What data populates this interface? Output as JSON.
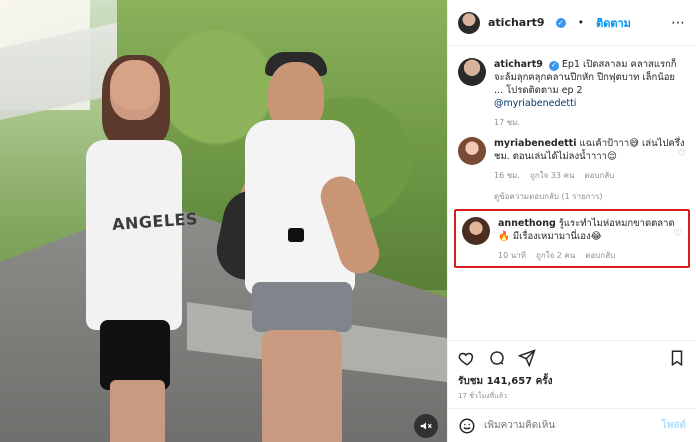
{
  "photo": {
    "shirt_text": "ANGELES",
    "mute_icon": "speaker-muted-icon"
  },
  "header": {
    "username": "atichart9",
    "follow_label": "ติดตาม",
    "more_icon": "more-horizontal-icon"
  },
  "post": {
    "caption_user": "atichart9",
    "caption_text": "Ep1 เปิดสลาลม คลาสแรกก็จะล้มลุกคลุกคลานปีกหัก ปีกฟุตบาท เล็กน้อย ... โปรดติดตาม ep 2",
    "caption_mention": "@myriabenedetti",
    "caption_time": "17 ชม."
  },
  "comments": [
    {
      "user": "myriabenedetti",
      "text": "แฉเค้าป้าาา😅 เล่นไปครึ่งชม. ตอนเล่นได้ไม่ลงน้ำาาา😌",
      "time": "16 ชม.",
      "likes": "ถูกใจ 33 คน",
      "reply": "ตอบกลับ",
      "view_replies": "ดูข้อความตอบกลับ (1 รายการ)"
    },
    {
      "user": "annethong",
      "text": "รู้แระทำไมห่อหมกขาดตลาด🔥 มีเรื่องเหมามานี่เอง😂",
      "time": "10 นาที",
      "likes": "ถูกใจ 2 คน",
      "reply": "ตอบกลับ"
    }
  ],
  "actions": {
    "like_icon": "heart-icon",
    "comment_icon": "comment-icon",
    "share_icon": "paper-plane-icon",
    "save_icon": "bookmark-icon"
  },
  "stats": {
    "likes_label": "รับชม 141,657 ครั้ง",
    "time_ago": "17 ชั่วโมงที่แล้ว"
  },
  "compose": {
    "placeholder": "เพิ่มความคิดเห็น",
    "post_label": "โพสต์",
    "emoji_icon": "smile-icon"
  },
  "colors": {
    "highlight": "#d51f1f",
    "accent": "#0095f6",
    "verified": "#3897f0"
  }
}
